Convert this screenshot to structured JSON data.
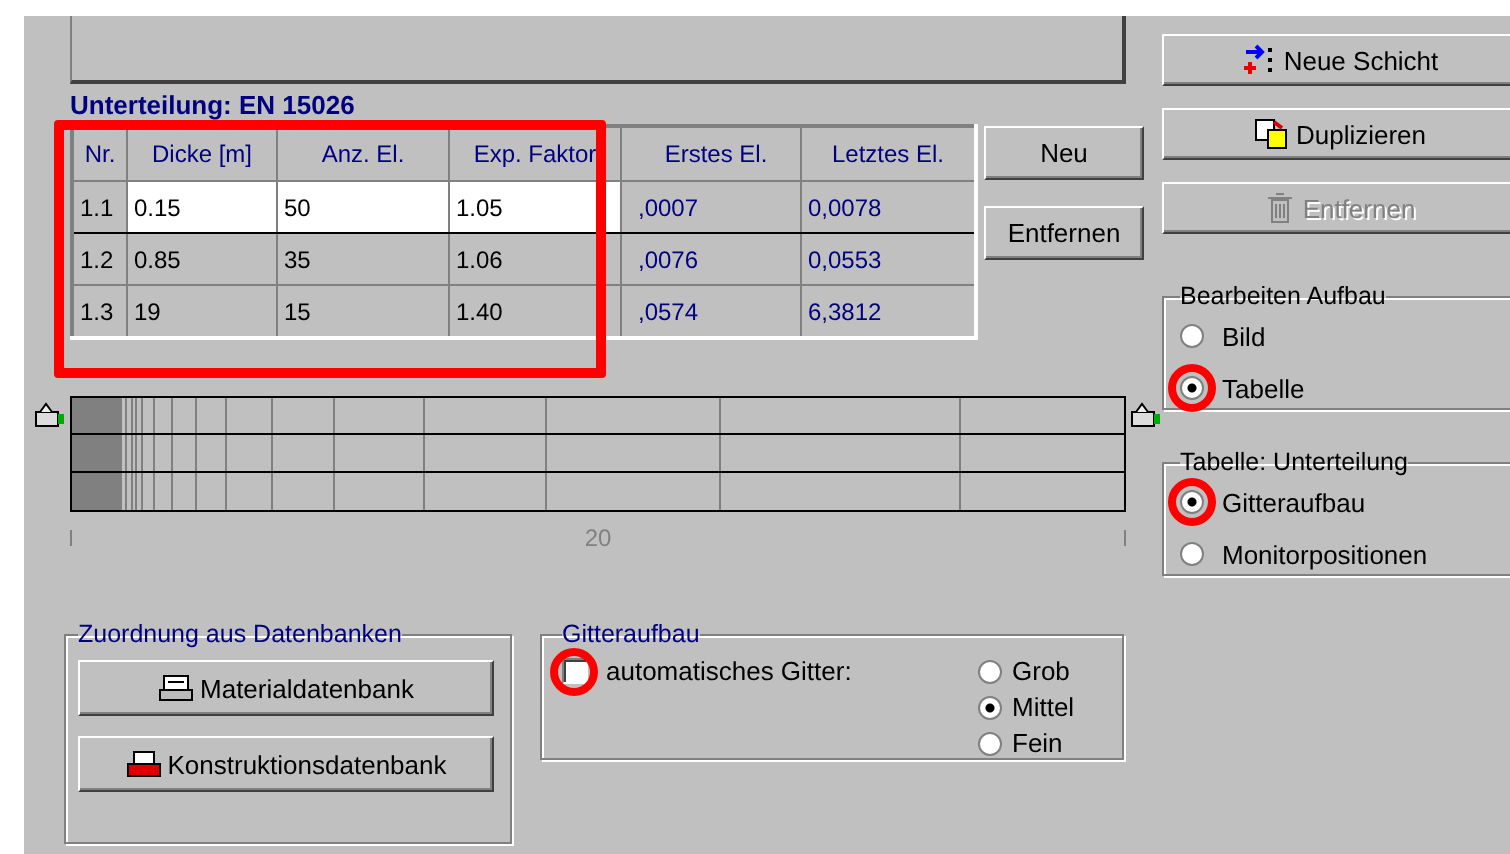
{
  "subdivision": {
    "title": "Unterteilung: EN 15026",
    "columns": [
      "Nr.",
      "Dicke [m]",
      "Anz. El.",
      "Exp. Faktor",
      "Erstes El.",
      "Letztes El."
    ],
    "rows": [
      {
        "cells": [
          "1.1",
          "0.15",
          "50",
          "1.05",
          ",0007",
          "0,0078"
        ],
        "selected": true
      },
      {
        "cells": [
          "1.2",
          "0.85",
          "35",
          "1.06",
          ",0076",
          "0,0553"
        ],
        "selected": false
      },
      {
        "cells": [
          "1.3",
          "19",
          "15",
          "1.40",
          ",0574",
          "6,3812"
        ],
        "selected": false
      }
    ],
    "buttons": [
      {
        "label": "Neu"
      },
      {
        "label": "Entfernen"
      }
    ]
  },
  "grid_axis": {
    "label": "20"
  },
  "database_group": {
    "title": "Zuordnung aus Datenbanken",
    "buttons": [
      {
        "label": "Materialdatenbank"
      },
      {
        "label": "Konstruktionsdatenbank"
      }
    ]
  },
  "grid_group": {
    "title": "Gitteraufbau",
    "auto_grid": {
      "label": "automatisches Gitter:",
      "checked": false
    },
    "options": [
      {
        "label": "Grob",
        "selected": false
      },
      {
        "label": "Mittel",
        "selected": true
      },
      {
        "label": "Fein",
        "selected": false
      }
    ]
  },
  "layer_buttons": [
    {
      "label": "Neue Schicht",
      "disabled": false
    },
    {
      "label": "Duplizieren",
      "disabled": false
    },
    {
      "label": "Entfernen",
      "disabled": true
    }
  ],
  "edit_group": {
    "title": "Bearbeiten Aufbau",
    "options": [
      {
        "label": "Bild",
        "selected": false
      },
      {
        "label": "Tabelle",
        "selected": true
      }
    ]
  },
  "table_group": {
    "title": "Tabelle: Unterteilung",
    "options": [
      {
        "label": "Gitteraufbau",
        "selected": true
      },
      {
        "label": "Monitorpositionen",
        "selected": false
      }
    ]
  }
}
